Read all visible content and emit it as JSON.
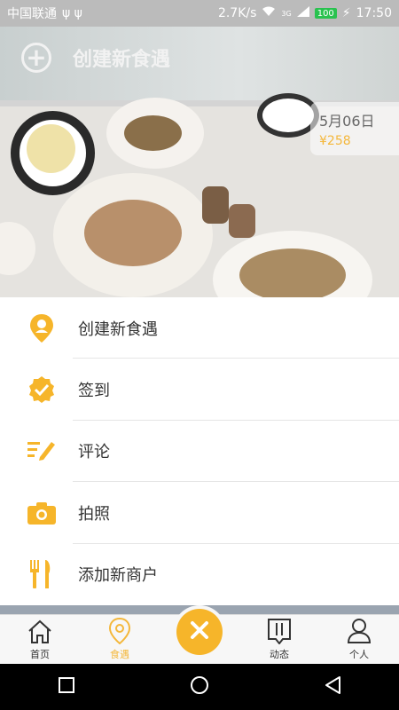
{
  "status_bar": {
    "carrier": "中国联通",
    "usb_icons": "ψ ψ",
    "net_speed": "2.7K/s",
    "network_type": "3G",
    "battery": "100",
    "time": "17:50"
  },
  "backdrop": {
    "create_title": "创建新食遇",
    "card_date": "5月06日",
    "card_price": "¥258"
  },
  "menu": {
    "items": [
      {
        "label": "创建新食遇",
        "icon": "location-pin-icon"
      },
      {
        "label": "签到",
        "icon": "check-badge-icon"
      },
      {
        "label": "评论",
        "icon": "comment-pen-icon"
      },
      {
        "label": "拍照",
        "icon": "camera-icon"
      },
      {
        "label": "添加新商户",
        "icon": "fork-knife-icon"
      }
    ]
  },
  "tabbar": {
    "tabs": [
      {
        "label": "首页",
        "icon": "home-icon",
        "active": false
      },
      {
        "label": "食遇",
        "icon": "location-at-icon",
        "active": true
      },
      {
        "label": "动态",
        "icon": "feed-icon",
        "active": false
      },
      {
        "label": "个人",
        "icon": "person-icon",
        "active": false
      }
    ],
    "fab_icon": "close-icon"
  },
  "navbar": {
    "buttons": [
      "recent-apps-icon",
      "home-circle-icon",
      "back-triangle-icon"
    ]
  },
  "colors": {
    "accent": "#f6b52a",
    "price": "#f4b73a",
    "text": "#333333"
  }
}
